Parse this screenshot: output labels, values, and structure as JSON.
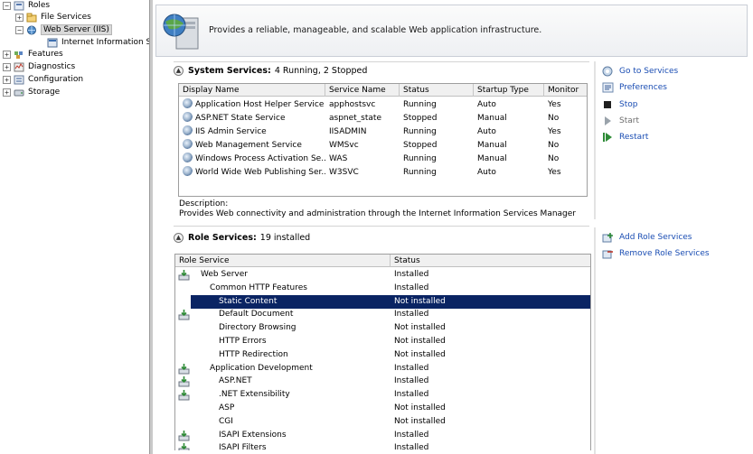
{
  "tree": {
    "roles": "Roles",
    "file_services": "File Services",
    "web_server": "Web Server (IIS)",
    "iis_manager": "Internet Information Se",
    "features": "Features",
    "diagnostics": "Diagnostics",
    "configuration": "Configuration",
    "storage": "Storage"
  },
  "summary": {
    "description": "Provides a reliable, manageable, and scalable Web application infrastructure."
  },
  "system_services": {
    "title": "System Services:",
    "status": "4 Running, 2 Stopped",
    "columns": [
      "Display Name",
      "Service Name",
      "Status",
      "Startup Type",
      "Monitor"
    ],
    "rows": [
      [
        "Application Host Helper Service",
        "apphostsvc",
        "Running",
        "Auto",
        "Yes"
      ],
      [
        "ASP.NET State Service",
        "aspnet_state",
        "Stopped",
        "Manual",
        "No"
      ],
      [
        "IIS Admin Service",
        "IISADMIN",
        "Running",
        "Auto",
        "Yes"
      ],
      [
        "Web Management Service",
        "WMSvc",
        "Stopped",
        "Manual",
        "No"
      ],
      [
        "Windows Process Activation Se...",
        "WAS",
        "Running",
        "Manual",
        "No"
      ],
      [
        "World Wide Web Publishing Ser...",
        "W3SVC",
        "Running",
        "Auto",
        "Yes"
      ]
    ],
    "description_label": "Description:",
    "description": "Provides Web connectivity and administration through the Internet Information Services Manager",
    "actions": {
      "go_to_services": "Go to Services",
      "preferences": "Preferences",
      "stop": "Stop",
      "start": "Start",
      "restart": "Restart"
    }
  },
  "role_services": {
    "title": "Role Services:",
    "status": "19 installed",
    "columns": [
      "Role Service",
      "Status"
    ],
    "rows": [
      {
        "name": "Web Server",
        "status": "Installed",
        "level": 1,
        "icon": true
      },
      {
        "name": "Common HTTP Features",
        "status": "Installed",
        "level": 2,
        "icon": false
      },
      {
        "name": "Static Content",
        "status": "Not installed",
        "level": 3,
        "icon": false,
        "selected": true
      },
      {
        "name": "Default Document",
        "status": "Installed",
        "level": 3,
        "icon": true
      },
      {
        "name": "Directory Browsing",
        "status": "Not installed",
        "level": 3,
        "icon": false
      },
      {
        "name": "HTTP Errors",
        "status": "Not installed",
        "level": 3,
        "icon": false
      },
      {
        "name": "HTTP Redirection",
        "status": "Not installed",
        "level": 3,
        "icon": false
      },
      {
        "name": "Application Development",
        "status": "Installed",
        "level": 2,
        "icon": true
      },
      {
        "name": "ASP.NET",
        "status": "Installed",
        "level": 3,
        "icon": true
      },
      {
        "name": ".NET Extensibility",
        "status": "Installed",
        "level": 3,
        "icon": true
      },
      {
        "name": "ASP",
        "status": "Not installed",
        "level": 3,
        "icon": false
      },
      {
        "name": "CGI",
        "status": "Not installed",
        "level": 3,
        "icon": false
      },
      {
        "name": "ISAPI Extensions",
        "status": "Installed",
        "level": 3,
        "icon": true
      },
      {
        "name": "ISAPI Filters",
        "status": "Installed",
        "level": 3,
        "icon": true
      }
    ],
    "actions": {
      "add": "Add Role Services",
      "remove": "Remove Role Services"
    }
  },
  "colors": {
    "selection": "#0a2463",
    "link": "#1a4db3"
  }
}
